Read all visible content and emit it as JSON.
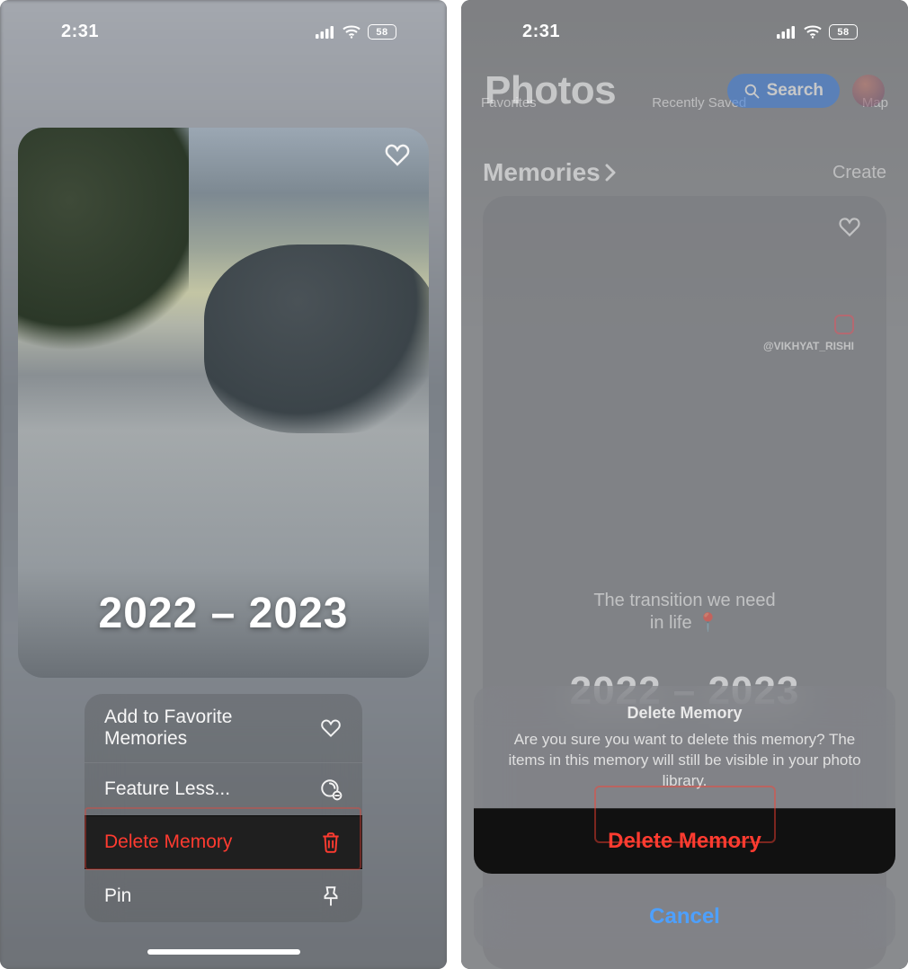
{
  "status": {
    "time": "2:31",
    "battery": "58"
  },
  "left": {
    "memory_title": "2022 – 2023",
    "menu": {
      "favorite": "Add to Favorite Memories",
      "feature_less": "Feature Less...",
      "delete": "Delete Memory",
      "pin": "Pin"
    }
  },
  "right": {
    "app_title": "Photos",
    "search_label": "Search",
    "subnav": {
      "favorites": "Favorites",
      "recently_saved": "Recently Saved",
      "map": "Map"
    },
    "section_name": "Memories",
    "create_label": "Create",
    "watermark_handle": "@VIKHYAT_RISHI",
    "overlay_line1": "The transition we need",
    "overlay_line2": "in life 📍",
    "memory_title": "2022 – 2023",
    "sheet": {
      "title": "Delete Memory",
      "message": "Are you sure you want to delete this memory? The items in this memory will still be visible in your photo library.",
      "delete": "Delete Memory",
      "cancel": "Cancel"
    }
  }
}
